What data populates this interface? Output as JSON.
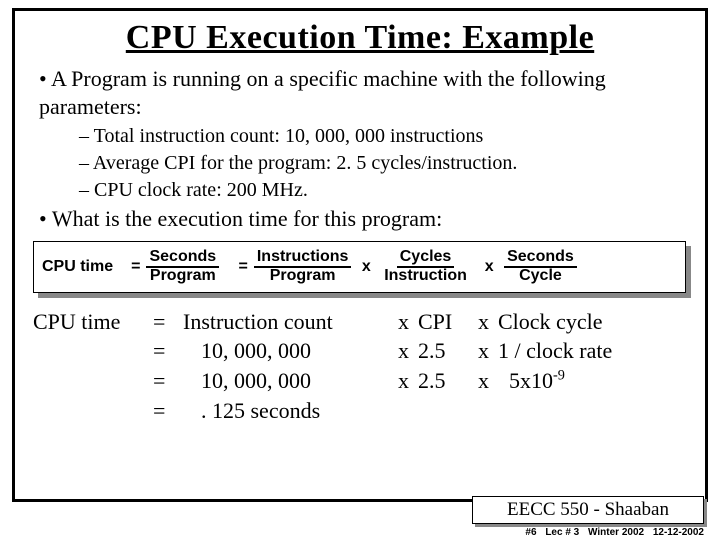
{
  "title": "CPU Execution Time: Example",
  "bullets": {
    "intro": "A Program is running on a specific machine with the following parameters:",
    "params": [
      "Total instruction count:      10, 000, 000  instructions",
      "Average CPI for the program:   2. 5  cycles/instruction.",
      "CPU clock rate:  200 MHz."
    ],
    "question": "What is the execution time for this program:"
  },
  "formula": {
    "label": "CPU time",
    "f1n": "Seconds",
    "f1d": "Program",
    "f2n": "Instructions",
    "f2d": "Program",
    "f3n": "Cycles",
    "f3d": "Instruction",
    "f4n": "Seconds",
    "f4d": "Cycle"
  },
  "derivation": {
    "lhs": "CPU time",
    "r1a": "Instruction count",
    "r1b": "CPI",
    "r1c": "Clock cycle",
    "r2a": "10, 000, 000",
    "r2b": "2.5",
    "r2c": "1 / clock rate",
    "r3a": "10, 000, 000",
    "r3b": "2.5",
    "r3c_pre": "5x10",
    "r3c_sup": "-9",
    "r4": ". 125  seconds"
  },
  "course": "EECC 550 - Shaaban",
  "footer": {
    "slide": "#6",
    "lec": "Lec # 3",
    "term": "Winter 2002",
    "date": "12-12-2002"
  }
}
